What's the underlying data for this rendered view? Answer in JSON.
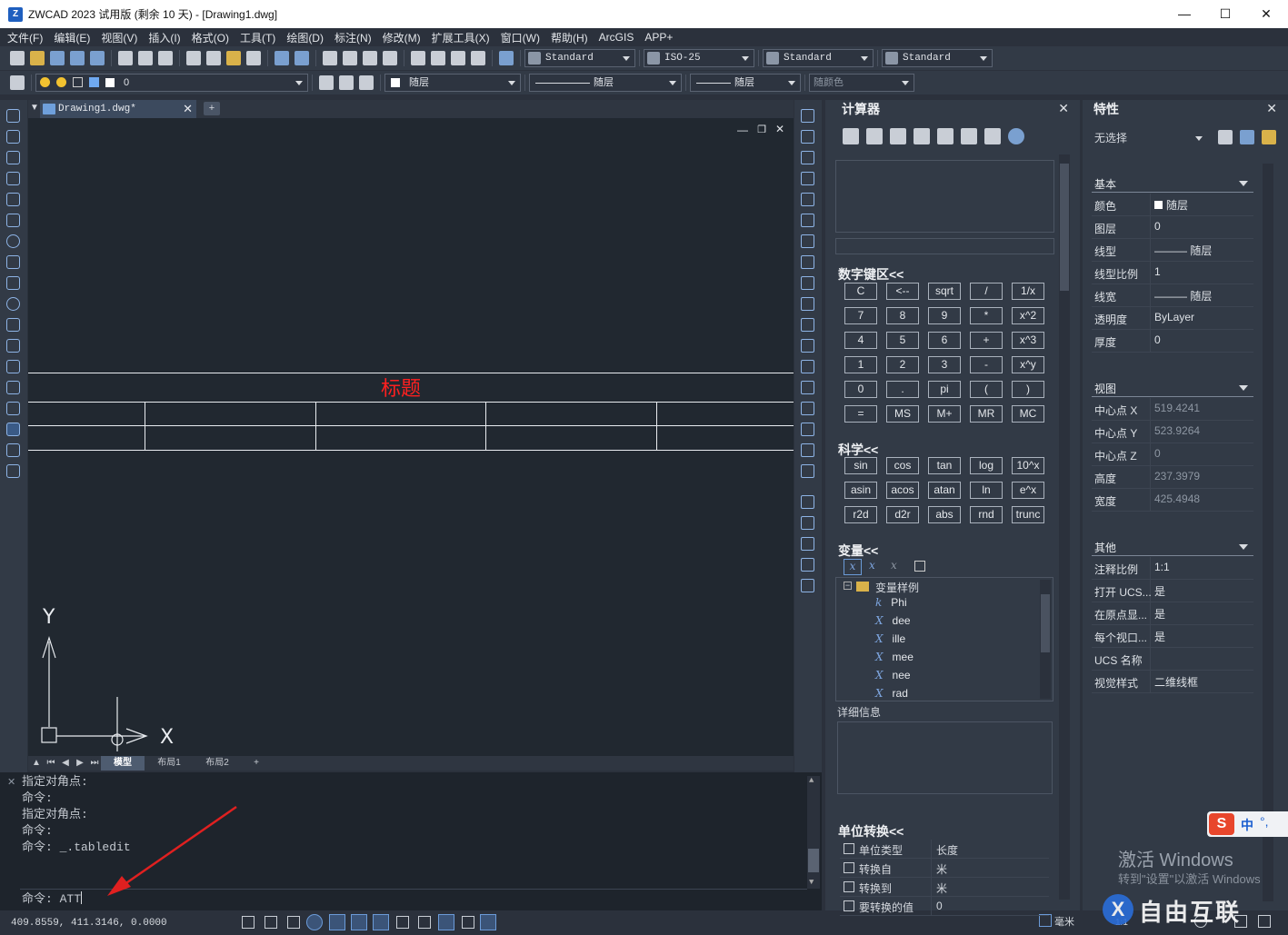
{
  "window": {
    "title": "ZWCAD 2023 试用版 (剩余 10 天) - [Drawing1.dwg]",
    "controls": {
      "minimize": "—",
      "maximize": "☐",
      "close": "✕"
    }
  },
  "menu": [
    "文件(F)",
    "编辑(E)",
    "视图(V)",
    "插入(I)",
    "格式(O)",
    "工具(T)",
    "绘图(D)",
    "标注(N)",
    "修改(M)",
    "扩展工具(X)",
    "窗口(W)",
    "帮助(H)",
    "ArcGIS",
    "APP+"
  ],
  "toolbar": {
    "text_style": "Standard",
    "dim_style": "ISO-25",
    "table_style": "Standard",
    "multileader_style": "Standard",
    "layer": "0",
    "color": "随层",
    "linetype": "随层",
    "lineweight": "随层",
    "plot_style": "随颜色"
  },
  "document": {
    "tab": "Drawing1.dwg*",
    "table_title": "标题",
    "axis_y": "Y",
    "axis_x": "X",
    "layout_tabs": [
      "模型",
      "布局1",
      "布局2",
      "+"
    ]
  },
  "command": {
    "history": [
      "指定对角点:",
      "命令:",
      "指定对角点:",
      "命令:",
      "命令: _.tabledit"
    ],
    "input": "命令: ATT"
  },
  "status": {
    "coords": "409.8559, 411.3146, 0.0000",
    "units": "毫米",
    "scale": "1:1"
  },
  "calculator": {
    "title": "计算器",
    "numpad_title": "数字键区<<",
    "numpad": [
      [
        "C",
        "<--",
        "sqrt",
        "/",
        "1/x"
      ],
      [
        "7",
        "8",
        "9",
        "*",
        "x^2"
      ],
      [
        "4",
        "5",
        "6",
        "+",
        "x^3"
      ],
      [
        "1",
        "2",
        "3",
        "-",
        "x^y"
      ],
      [
        "0",
        ".",
        "pi",
        "(",
        ")"
      ],
      [
        "=",
        "MS",
        "M+",
        "MR",
        "MC"
      ]
    ],
    "sci_title": "科学<<",
    "sci": [
      [
        "sin",
        "cos",
        "tan",
        "log",
        "10^x"
      ],
      [
        "asin",
        "acos",
        "atan",
        "ln",
        "e^x"
      ],
      [
        "r2d",
        "d2r",
        "abs",
        "rnd",
        "trunc"
      ]
    ],
    "vars_title": "变量<<",
    "var_root": "变量样例",
    "vars": [
      {
        "icon": "k",
        "name": "Phi"
      },
      {
        "icon": "X",
        "name": "dee"
      },
      {
        "icon": "X",
        "name": "ille"
      },
      {
        "icon": "X",
        "name": "mee"
      },
      {
        "icon": "X",
        "name": "nee"
      },
      {
        "icon": "X",
        "name": "rad"
      }
    ],
    "details_label": "详细信息",
    "units_title": "单位转换<<",
    "units": [
      {
        "k": "单位类型",
        "v": "长度"
      },
      {
        "k": "转换自",
        "v": "米"
      },
      {
        "k": "转换到",
        "v": "米"
      },
      {
        "k": "要转换的值",
        "v": "0"
      }
    ]
  },
  "properties": {
    "title": "特性",
    "selection": "无选择",
    "groups": {
      "basic": {
        "title": "基本",
        "rows": [
          {
            "k": "颜色",
            "v": "随层"
          },
          {
            "k": "图层",
            "v": "0"
          },
          {
            "k": "线型",
            "v": "——— 随层"
          },
          {
            "k": "线型比例",
            "v": "1"
          },
          {
            "k": "线宽",
            "v": "——— 随层"
          },
          {
            "k": "透明度",
            "v": "ByLayer"
          },
          {
            "k": "厚度",
            "v": "0"
          }
        ]
      },
      "view": {
        "title": "视图",
        "rows": [
          {
            "k": "中心点 X",
            "v": "519.4241"
          },
          {
            "k": "中心点 Y",
            "v": "523.9264"
          },
          {
            "k": "中心点 Z",
            "v": "0"
          },
          {
            "k": "高度",
            "v": "237.3979"
          },
          {
            "k": "宽度",
            "v": "425.4948"
          }
        ]
      },
      "misc": {
        "title": "其他",
        "rows": [
          {
            "k": "注释比例",
            "v": "1:1"
          },
          {
            "k": "打开 UCS...",
            "v": "是"
          },
          {
            "k": "在原点显...",
            "v": "是"
          },
          {
            "k": "每个视口...",
            "v": "是"
          },
          {
            "k": "UCS 名称",
            "v": ""
          },
          {
            "k": "视觉样式",
            "v": "二维线框"
          }
        ]
      }
    }
  },
  "overlays": {
    "activate_title": "激活 Windows",
    "activate_sub": "转到\"设置\"以激活 Windows",
    "ime": "中",
    "watermark": "自由互联"
  }
}
